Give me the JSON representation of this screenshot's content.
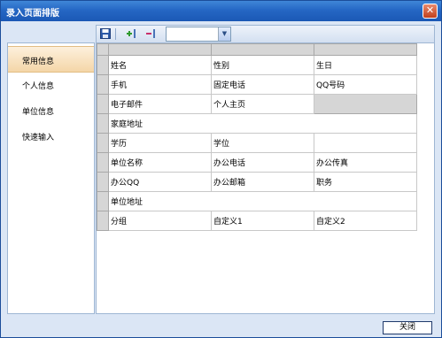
{
  "window": {
    "title": "录入页面排版",
    "close_glyph": "✕"
  },
  "sidebar": {
    "items": [
      {
        "label": "常用信息",
        "active": true
      },
      {
        "label": "个人信息",
        "active": false
      },
      {
        "label": "单位信息",
        "active": false
      },
      {
        "label": "快速输入",
        "active": false
      }
    ]
  },
  "toolbar": {
    "icons": [
      "save-icon",
      "add-column-icon",
      "remove-column-icon"
    ],
    "select_value": "",
    "select_arrow": "▼"
  },
  "grid": {
    "rows": [
      [
        "姓名",
        "性别",
        "生日"
      ],
      [
        "手机",
        "固定电话",
        "QQ号码"
      ],
      [
        "电子邮件",
        "个人主页",
        null
      ],
      [
        "家庭地址"
      ],
      [
        "学历",
        "学位",
        ""
      ],
      [
        "单位名称",
        "办公电话",
        "办公传真"
      ],
      [
        "办公QQ",
        "办公邮箱",
        "职务"
      ],
      [
        "单位地址"
      ],
      [
        "分组",
        "自定义1",
        "自定义2"
      ]
    ]
  },
  "footer": {
    "close_label": "关闭"
  }
}
